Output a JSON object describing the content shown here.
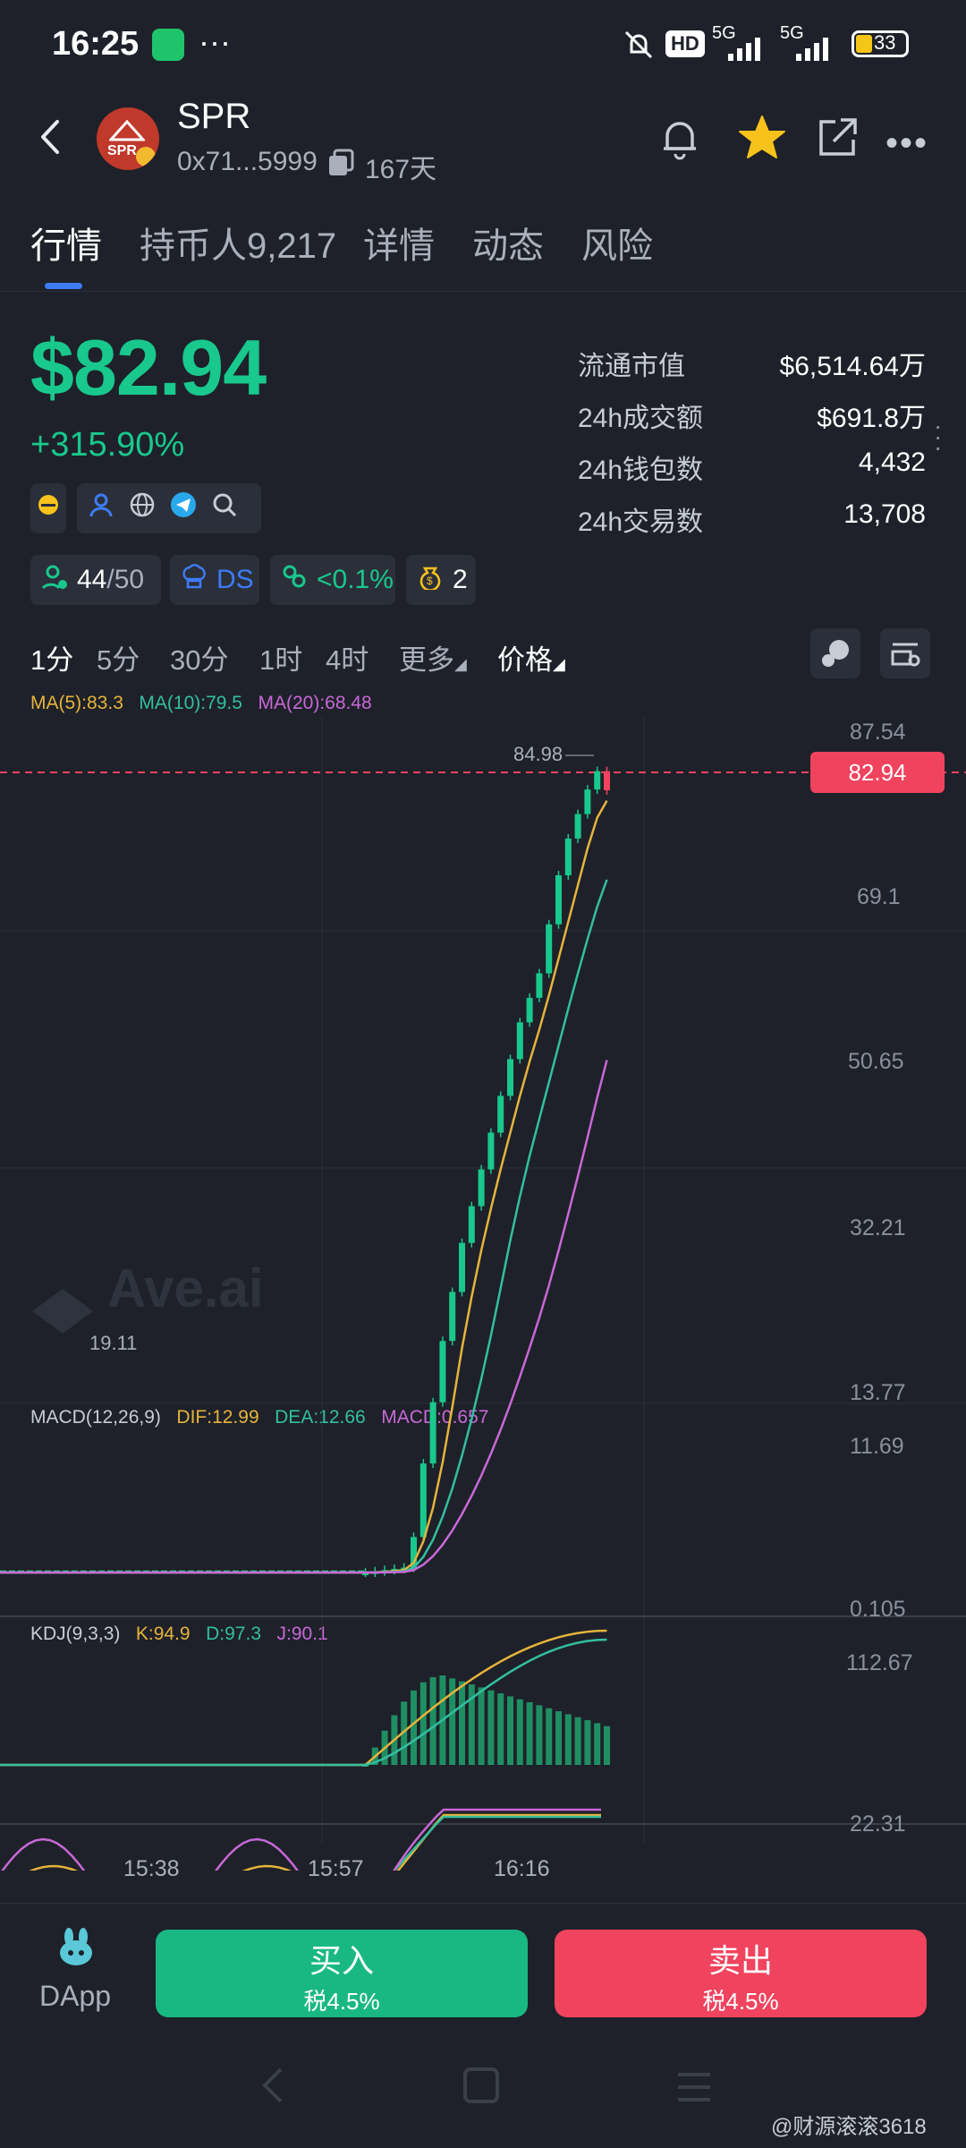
{
  "status_bar": {
    "time": "16:25",
    "battery": "33",
    "network1": "5G",
    "network2": "5G",
    "hd": "HD"
  },
  "token": {
    "symbol": "SPR",
    "address": "0x71...5999",
    "age": "167天",
    "logo_text": "SPR"
  },
  "tabs": [
    "行情",
    "持币人9,217",
    "详情",
    "动态",
    "风险"
  ],
  "price": {
    "value": "$82.94",
    "change": "+315.90%"
  },
  "stats": [
    {
      "label": "流通市值",
      "value": "$6,514.64万"
    },
    {
      "label": "24h成交额",
      "value": "$691.8万"
    },
    {
      "label": "24h钱包数",
      "value": "4,432"
    },
    {
      "label": "24h交易数",
      "value": "13,708"
    }
  ],
  "chips": {
    "holders_a": "44",
    "holders_b": "/50",
    "ds": "DS",
    "share": "<0.1%",
    "bags": "2"
  },
  "timeframes": [
    "1分",
    "5分",
    "30分",
    "1时",
    "4时",
    "更多",
    "价格"
  ],
  "ma_legend": {
    "ma5": "MA(5):83.3",
    "ma10": "MA(10):79.5",
    "ma20": "MA(20):68.48"
  },
  "macd_legend": {
    "title": "MACD(12,26,9)",
    "dif": "DIF:12.99",
    "dea": "DEA:12.66",
    "macd": "MACD:0.657"
  },
  "kdj_legend": {
    "title": "KDJ(9,3,3)",
    "k": "K:94.9",
    "d": "D:97.3",
    "j": "J:90.1"
  },
  "price_axis": [
    "87.54",
    "69.1",
    "50.65",
    "32.21",
    "13.77"
  ],
  "macd_axis": [
    "11.69",
    "0.105"
  ],
  "kdj_axis": [
    "112.67",
    "22.31"
  ],
  "time_axis": [
    "15:38",
    "15:57",
    "16:16"
  ],
  "chart_annotations": {
    "high": "84.98",
    "low": "19.11",
    "current": "82.94",
    "watermark": "Ave.ai"
  },
  "bottom": {
    "dapp": "DApp",
    "buy": "买入",
    "buy_tax": "税4.5%",
    "sell": "卖出",
    "sell_tax": "税4.5%"
  },
  "watermark": "@财源滚滚3618",
  "colors": {
    "up": "#19c88c",
    "down": "#f0435e",
    "ma5": "#e6b43c",
    "ma10": "#33bfa0",
    "ma20": "#c868d8",
    "accent": "#3d7cf5"
  },
  "chart_data": {
    "type": "candlestick",
    "x_ticks": [
      "15:38",
      "15:57",
      "16:16"
    ],
    "ylim": [
      13.77,
      87.54
    ],
    "close_approx": [
      19.1,
      19.2,
      19.3,
      19.4,
      19.5,
      22,
      28,
      33,
      38,
      42,
      46,
      49,
      52,
      55,
      58,
      61,
      64,
      66,
      68,
      72,
      76,
      79,
      81,
      83,
      84.5,
      82.94
    ],
    "high": 84.98,
    "current": 82.94
  }
}
